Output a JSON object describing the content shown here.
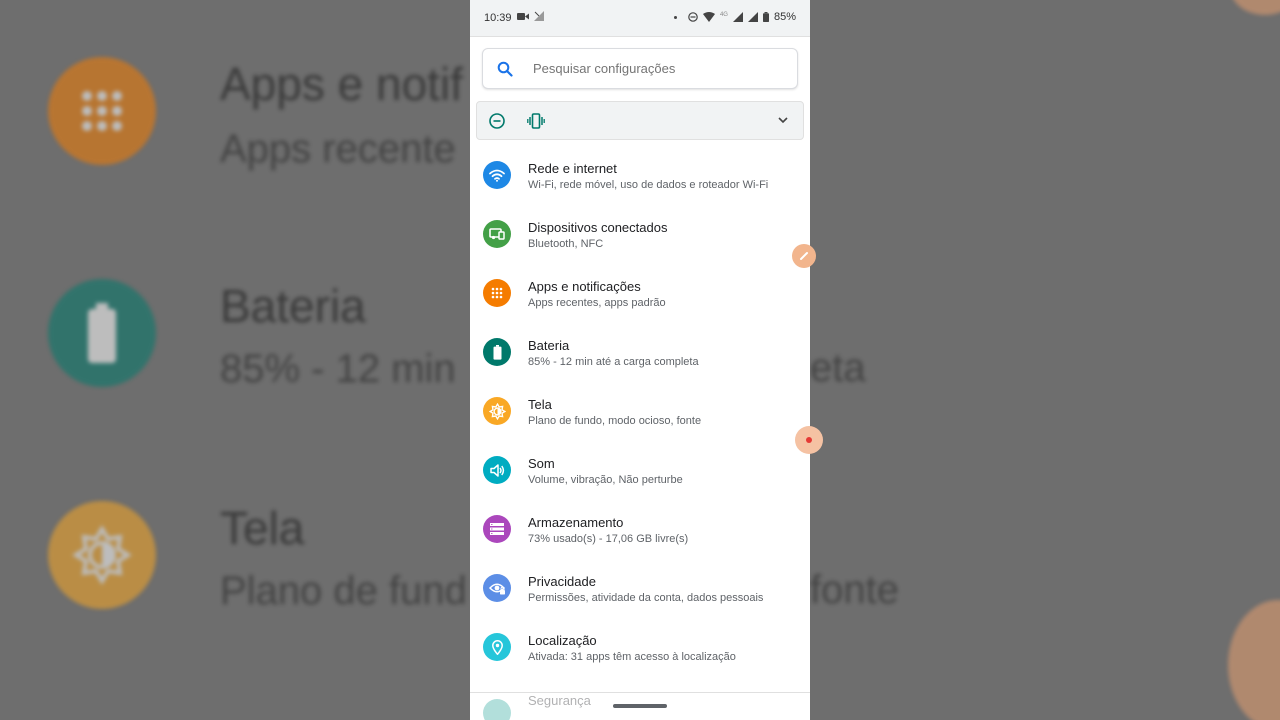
{
  "status_bar": {
    "time": "10:39",
    "network_type": "4G",
    "battery": "85%"
  },
  "search": {
    "placeholder": "Pesquisar configurações"
  },
  "settings": [
    {
      "title": "Rede e internet",
      "subtitle": "Wi-Fi, rede móvel, uso de dados e roteador Wi-Fi",
      "icon": "wifi-icon",
      "color": "#1e88e5"
    },
    {
      "title": "Dispositivos conectados",
      "subtitle": "Bluetooth, NFC",
      "icon": "devices-icon",
      "color": "#43a047"
    },
    {
      "title": "Apps e notificações",
      "subtitle": "Apps recentes, apps padrão",
      "icon": "apps-grid-icon",
      "color": "#f57c00"
    },
    {
      "title": "Bateria",
      "subtitle": "85% - 12 min até a carga completa",
      "icon": "battery-icon",
      "color": "#00796b"
    },
    {
      "title": "Tela",
      "subtitle": "Plano de fundo, modo ocioso, fonte",
      "icon": "brightness-icon",
      "color": "#f9a825"
    },
    {
      "title": "Som",
      "subtitle": "Volume, vibração, Não perturbe",
      "icon": "volume-icon",
      "color": "#00acc1"
    },
    {
      "title": "Armazenamento",
      "subtitle": "73% usado(s) - 17,06 GB livre(s)",
      "icon": "storage-icon",
      "color": "#ab47bc"
    },
    {
      "title": "Privacidade",
      "subtitle": "Permissões, atividade da conta, dados pessoais",
      "icon": "privacy-eye-icon",
      "color": "#5c8ee6"
    },
    {
      "title": "Localização",
      "subtitle": "Ativada: 31 apps têm acesso à localização",
      "icon": "location-pin-icon",
      "color": "#26c6da"
    }
  ],
  "partial_item": {
    "title": "Segurança",
    "icon": "security-icon",
    "color": "#26a69a"
  },
  "background": {
    "apps_title": "Apps e notif",
    "apps_sub": "Apps recente",
    "battery_title": "Bateria",
    "battery_sub": "85% - 12 min",
    "battery_sub_right": "eta",
    "display_title": "Tela",
    "display_sub": "Plano de fund",
    "display_sub_right": "fonte"
  }
}
